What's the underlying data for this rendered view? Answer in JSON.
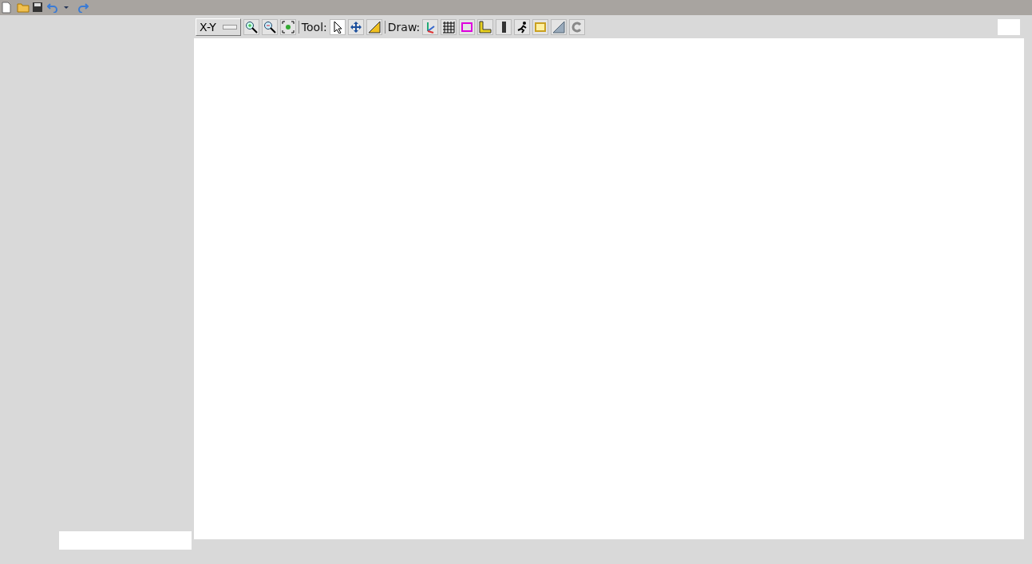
{
  "view_select": {
    "value": "X-Y"
  },
  "tool_label": "Tool:",
  "tools": [
    {
      "kind": "pointer",
      "selected": true
    },
    {
      "kind": "move",
      "selected": false
    },
    {
      "kind": "measure",
      "selected": false
    }
  ],
  "draw_label": "Draw:",
  "draw_items": [
    {
      "kind": "axes"
    },
    {
      "kind": "grid"
    },
    {
      "kind": "box"
    },
    {
      "kind": "ruler"
    },
    {
      "kind": "bar"
    },
    {
      "kind": "runner"
    },
    {
      "kind": "frame"
    },
    {
      "kind": "hatch"
    },
    {
      "kind": "refresh"
    }
  ]
}
